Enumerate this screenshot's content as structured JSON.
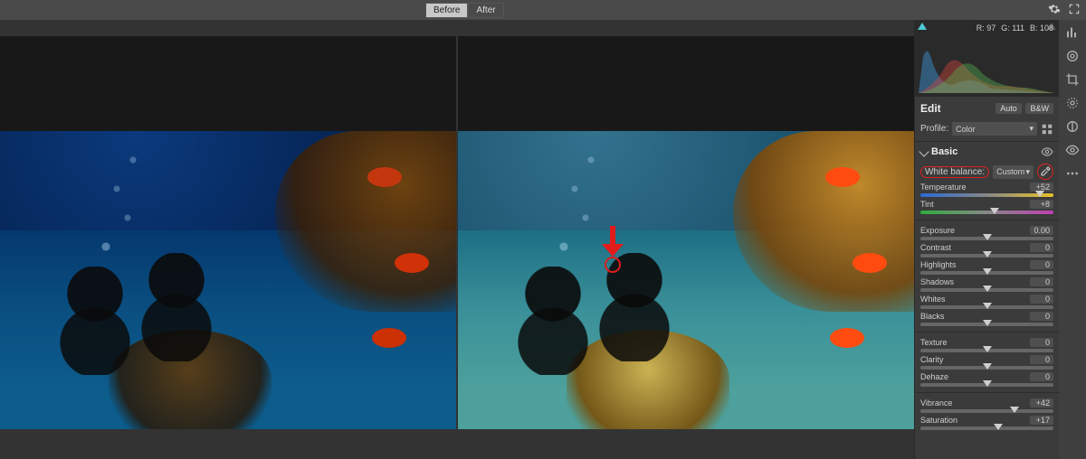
{
  "topbar": {
    "before_label": "Before",
    "after_label": "After"
  },
  "histogram": {
    "R": "R: 97",
    "G": "G: 111",
    "B": "B: 108"
  },
  "edit": {
    "title": "Edit",
    "auto": "Auto",
    "bw": "B&W",
    "profile_label": "Profile:",
    "profile_value": "Color"
  },
  "basic": {
    "title": "Basic",
    "wb_label": "White balance:",
    "wb_value": "Custom",
    "sliders": {
      "temperature": {
        "label": "Temperature",
        "value": "+52",
        "pos": 0.9,
        "grad": "gradient-temp"
      },
      "tint": {
        "label": "Tint",
        "value": "+8",
        "pos": 0.56,
        "grad": "gradient-tint"
      },
      "exposure": {
        "label": "Exposure",
        "value": "0.00",
        "pos": 0.5
      },
      "contrast": {
        "label": "Contrast",
        "value": "0",
        "pos": 0.5
      },
      "highlights": {
        "label": "Highlights",
        "value": "0",
        "pos": 0.5
      },
      "shadows": {
        "label": "Shadows",
        "value": "0",
        "pos": 0.5
      },
      "whites": {
        "label": "Whites",
        "value": "0",
        "pos": 0.5
      },
      "blacks": {
        "label": "Blacks",
        "value": "0",
        "pos": 0.5
      },
      "texture": {
        "label": "Texture",
        "value": "0",
        "pos": 0.5
      },
      "clarity": {
        "label": "Clarity",
        "value": "0",
        "pos": 0.5
      },
      "dehaze": {
        "label": "Dehaze",
        "value": "0",
        "pos": 0.5
      },
      "vibrance": {
        "label": "Vibrance",
        "value": "+42",
        "pos": 0.71
      },
      "saturation": {
        "label": "Saturation",
        "value": "+17",
        "pos": 0.585
      }
    }
  }
}
